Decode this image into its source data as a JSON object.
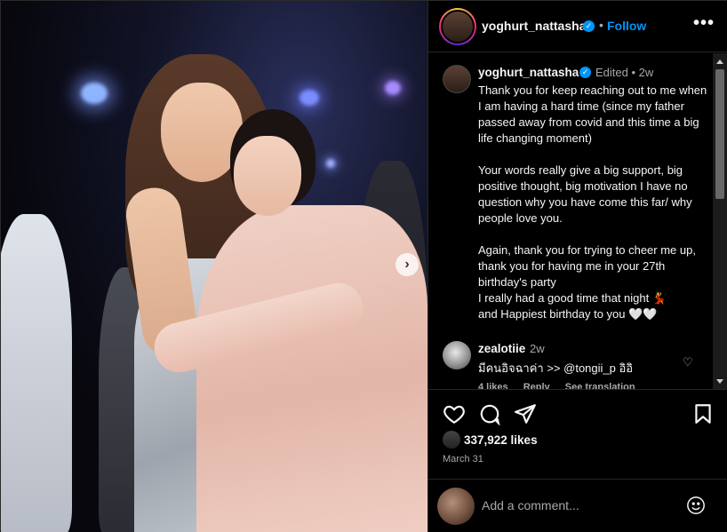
{
  "post": {
    "username": "yoghurt_nattasha",
    "follow_label": "Follow",
    "separator": "•",
    "more_label": "•••",
    "next_label": "›"
  },
  "caption": {
    "username": "yoghurt_nattasha",
    "meta": "Edited • 2w",
    "text": "Thank you for keep reaching out to me when I am having a hard time (since my father passed away from covid and this time a big life changing moment)\n\nYour words really give a big support, big positive thought, big motivation I have no question why you have come this far/ why people love you.\n\nAgain, thank you for trying to cheer me up, thank you for having me in your 27th birthday's party\nI really had a good time that night 💃\nand Happiest birthday to you 🤍🤍"
  },
  "comment": {
    "username": "zealotiie",
    "time": "2w",
    "text": "มีคนอิจฉาค่า >> @tongii_p อิอิ",
    "likes": "4 likes",
    "reply": "Reply",
    "see_translation": "See translation"
  },
  "stats": {
    "likes": "337,922 likes",
    "date": "March 31"
  },
  "add_comment": {
    "placeholder": "Add a comment..."
  },
  "colors": {
    "accent": "#0095f6",
    "background": "#000000",
    "text": "#f5f5f5",
    "muted": "#a8a8a8"
  },
  "icons": [
    "verified-badge-icon",
    "more-options-icon",
    "next-slide-icon",
    "heart-icon",
    "comment-icon",
    "share-icon",
    "bookmark-icon",
    "emoji-icon"
  ]
}
